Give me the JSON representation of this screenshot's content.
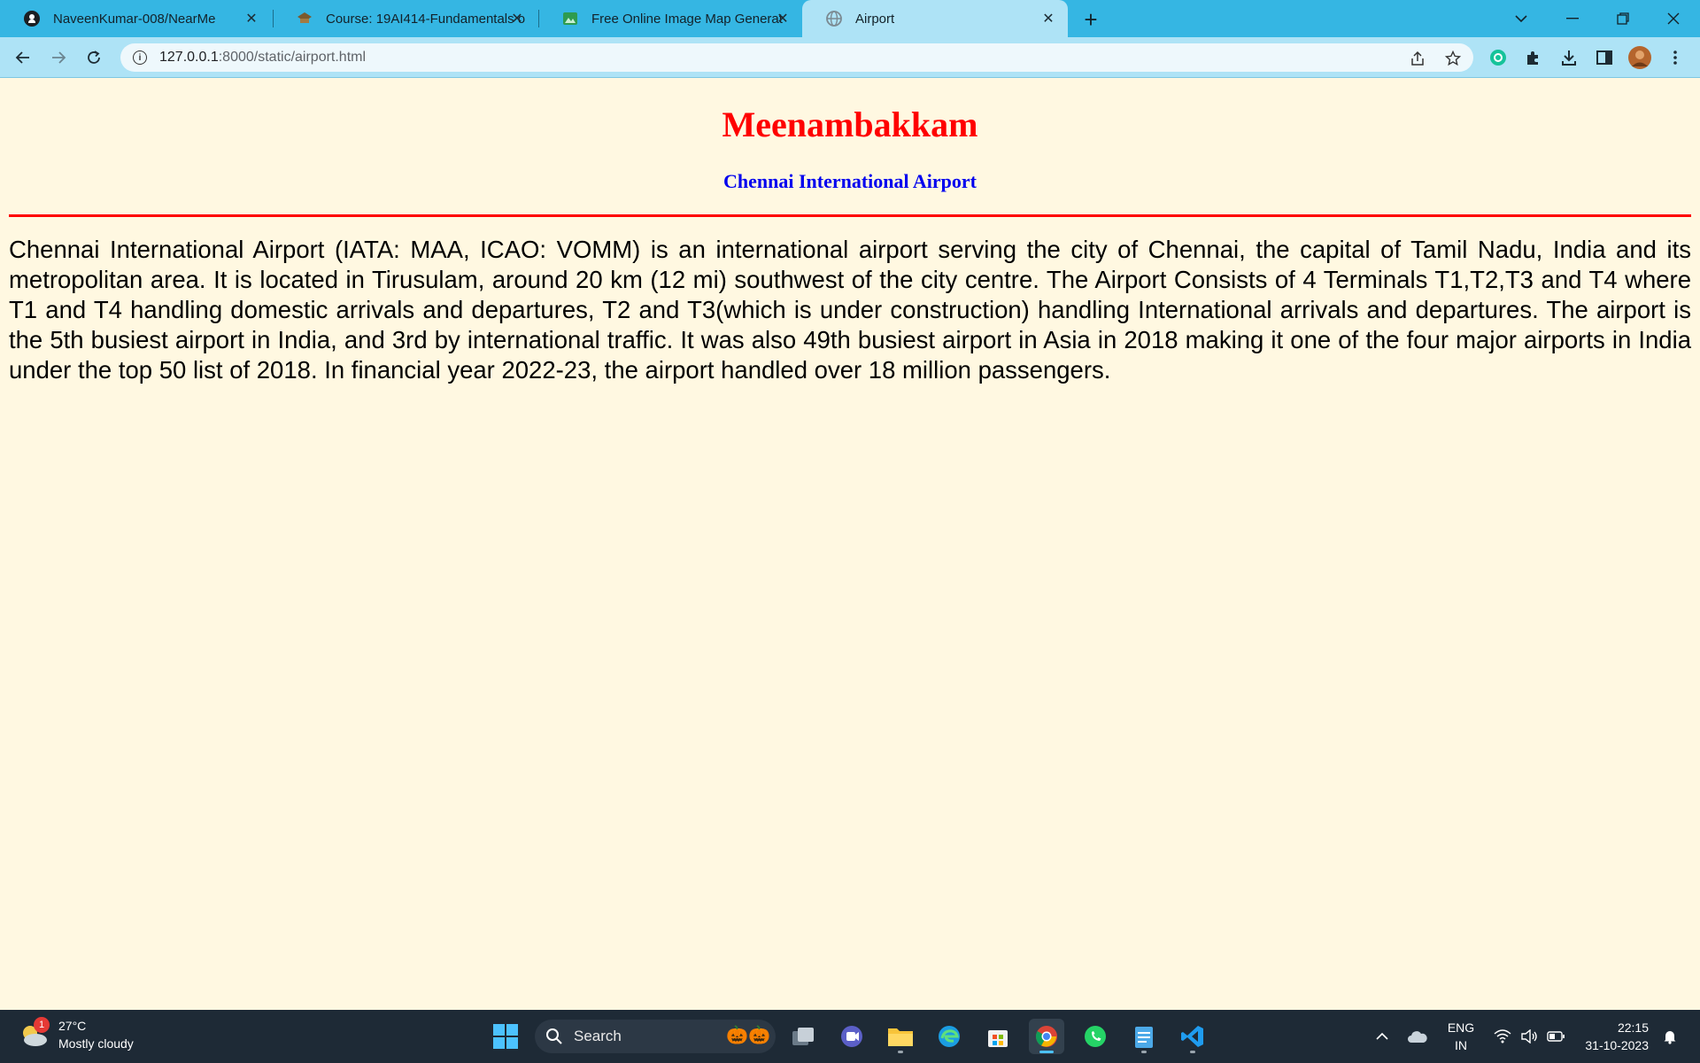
{
  "browser": {
    "tabs": [
      {
        "label": "NaveenKumar-008/NearMe",
        "icon": "github-icon"
      },
      {
        "label": "Course: 19AI414-Fundamentals o",
        "icon": "course-icon"
      },
      {
        "label": "Free Online Image Map Generat",
        "icon": "image-map-icon"
      },
      {
        "label": "Airport",
        "icon": "globe-icon"
      }
    ],
    "url_host": "127.0.0.1",
    "url_path": ":8000/static/airport.html"
  },
  "page": {
    "title": "Meenambakkam",
    "subtitle": "Chennai International Airport",
    "body": "Chennai International Airport (IATA: MAA, ICAO: VOMM) is an international airport serving the city of Chennai, the capital of Tamil Nadu, India and its metropolitan area. It is located in Tirusulam, around 20 km (12 mi) southwest of the city centre. The Airport Consists of 4 Terminals T1,T2,T3 and T4 where T1 and T4 handling domestic arrivals and departures, T2 and T3(which is under construction) handling International arrivals and departures. The airport is the 5th busiest airport in India, and 3rd by international traffic. It was also 49th busiest airport in Asia in 2018 making it one of the four major airports in India under the top 50 list of 2018. In financial year 2022-23, the airport handled over 18 million passengers.",
    "title_color": "#ff0000",
    "subtitle_color": "#0000ee",
    "background_color": "#fff8e1"
  },
  "taskbar": {
    "weather_temp": "27°C",
    "weather_desc": "Mostly cloudy",
    "weather_badge": "1",
    "search_label": "Search",
    "lang_line1": "ENG",
    "lang_line2": "IN",
    "time": "22:15",
    "date": "31-10-2023"
  }
}
